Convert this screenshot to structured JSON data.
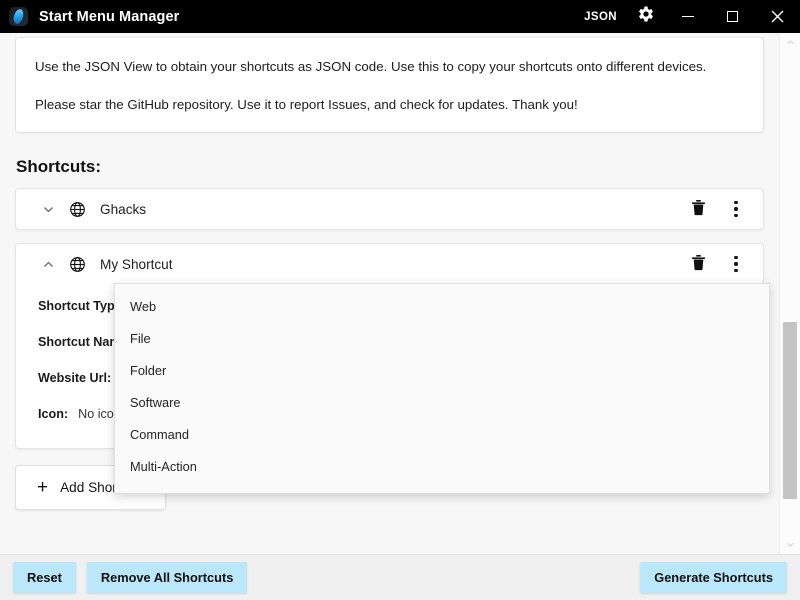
{
  "titlebar": {
    "app_title": "Start Menu Manager",
    "app_icon": "app-logo-icon",
    "json_label": "JSON",
    "gear_icon": "gear-icon",
    "minimize_label": "Minimize",
    "maximize_label": "Maximize",
    "close_label": "Close",
    "background": "#000000",
    "foreground": "#ffffff"
  },
  "info_card": {
    "paragraph_1": "Use the JSON View to obtain your shortcuts as JSON code. Use this to copy your shortcuts onto different devices.",
    "paragraph_2": "Please star the GitHub repository. Use it to report Issues, and check for updates. Thank you!"
  },
  "shortcuts_section": {
    "heading": "Shortcuts:",
    "items": [
      {
        "name": "Ghacks",
        "type_icon": "globe-icon",
        "expanded": false,
        "chevron": "chevron-down-icon",
        "delete_icon": "trash-icon",
        "menu_icon": "more-vertical-icon"
      },
      {
        "name": "My Shortcut",
        "type_icon": "globe-icon",
        "expanded": true,
        "chevron": "chevron-up-icon",
        "delete_icon": "trash-icon",
        "menu_icon": "more-vertical-icon",
        "fields": [
          {
            "label": "Shortcut Type:",
            "value": ""
          },
          {
            "label": "Shortcut Name:",
            "value": ""
          },
          {
            "label": "Website Url:",
            "value": ""
          },
          {
            "label": "Icon:",
            "value": "No icon"
          }
        ]
      }
    ],
    "add_button": {
      "label": "Add Shortcut",
      "icon": "plus-icon"
    }
  },
  "dropdown": {
    "open": true,
    "options": [
      "Web",
      "File",
      "Folder",
      "Software",
      "Command",
      "Multi-Action"
    ]
  },
  "scrollbar": {
    "up_icon": "chevron-up-icon",
    "down_icon": "chevron-down-icon",
    "thumb_color": "#c4c4c4"
  },
  "bottombar": {
    "reset_label": "Reset",
    "remove_all_label": "Remove All Shortcuts",
    "generate_label": "Generate Shortcuts",
    "button_color": "#bbe7fb"
  }
}
